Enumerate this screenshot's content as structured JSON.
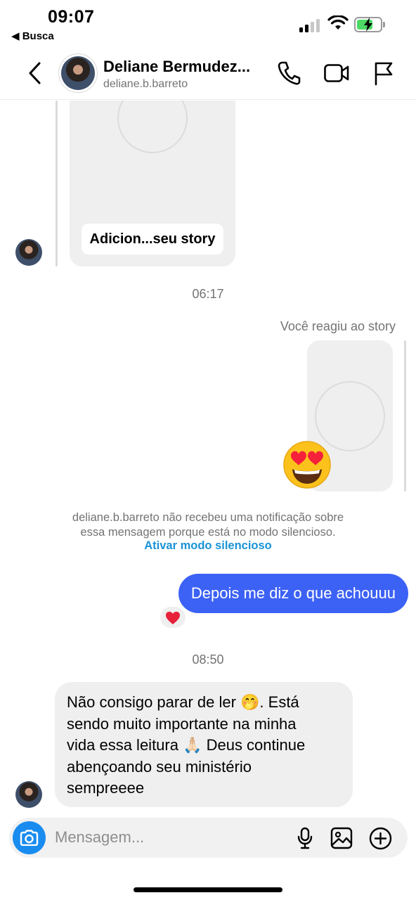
{
  "status_bar": {
    "time": "09:07",
    "back_app": "◀ Busca"
  },
  "header": {
    "contact_name": "Deliane Bermudez...",
    "contact_handle": "deliane.b.barreto",
    "icons": [
      "back-chevron-icon",
      "phone-icon",
      "video-camera-icon",
      "flag-icon"
    ]
  },
  "messages": {
    "story_label": "Adicion...seu story",
    "time_1": "06:17",
    "reacted_story_note": "Você reagiu ao story",
    "reaction_emoji": "heart-eyes",
    "notice_line1": "deliane.b.barreto não recebeu uma notificação sobre",
    "notice_line2": "essa mensagem porque está no modo silencioso.",
    "notice_link": "Ativar modo silencioso",
    "outgoing_text": "Depois me diz o que achouuu",
    "outgoing_reaction": "❤️",
    "time_2": "08:50",
    "incoming_lines": [
      "Não consigo parar de ler 🤭. Está",
      "sendo muito importante na minha",
      "vida essa leitura 🙏🏻 Deus continue",
      "abençoando seu ministério",
      "sempreeee"
    ]
  },
  "composer": {
    "placeholder": "Mensagem..."
  },
  "colors": {
    "outgoing_bubble": "#3c61f5",
    "incoming_bubble": "#efefef",
    "link": "#1a93d6",
    "camera_button": "#1a8cf0"
  }
}
